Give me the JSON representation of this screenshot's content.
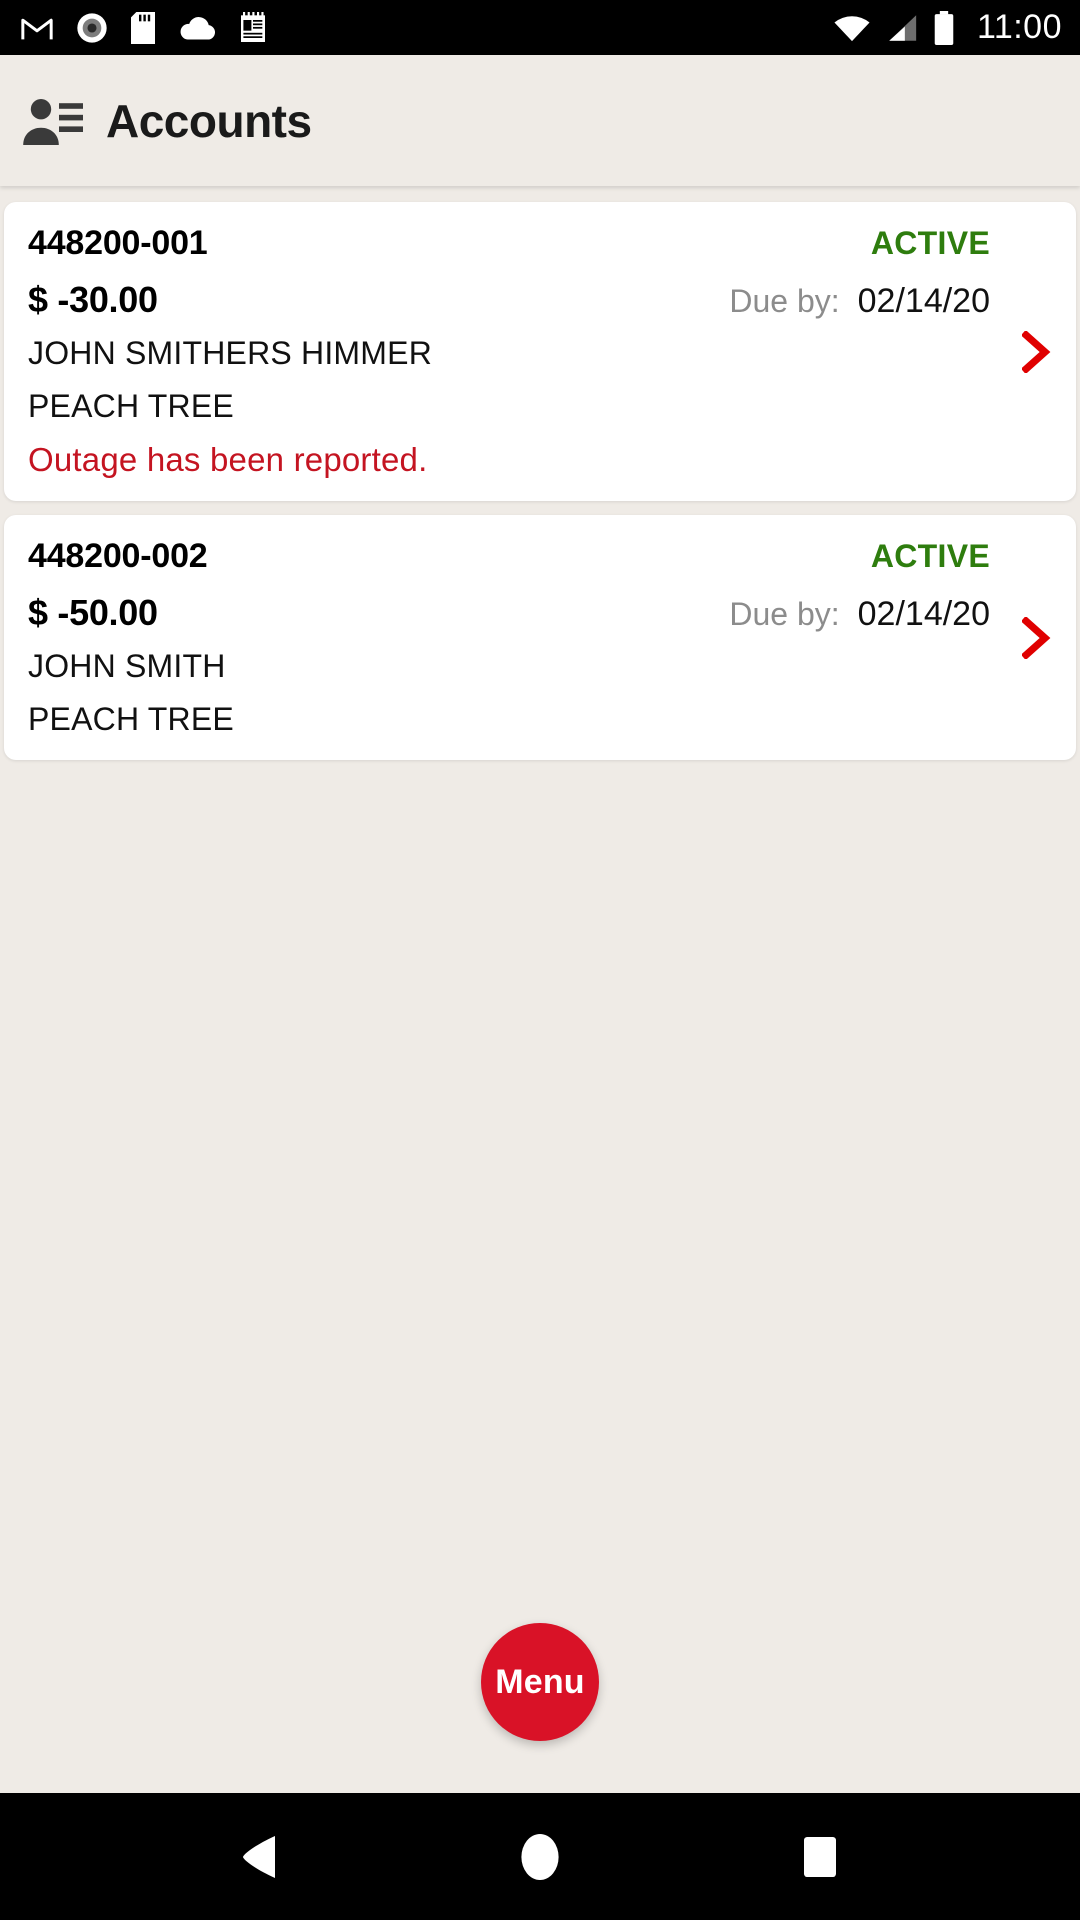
{
  "statusbar": {
    "time": "11:00",
    "left_icons": [
      "gmail-icon",
      "record-disc-icon",
      "sd-card-icon",
      "cloud-icon",
      "notepad-icon"
    ],
    "right_icons": [
      "wifi-icon",
      "cellular-signal-icon",
      "battery-icon"
    ]
  },
  "appbar": {
    "icon": "contacts-icon",
    "title": "Accounts"
  },
  "accounts": [
    {
      "number": "448200-001",
      "status": "ACTIVE",
      "amount": "$ -30.00",
      "due_label": "Due by:",
      "due_date": "02/14/20",
      "customer": "JOHN SMITHERS HIMMER",
      "address": "PEACH TREE",
      "notice": "Outage has been reported."
    },
    {
      "number": "448200-002",
      "status": "ACTIVE",
      "amount": "$ -50.00",
      "due_label": "Due by:",
      "due_date": "02/14/20",
      "customer": "JOHN SMITH",
      "address": "PEACH TREE",
      "notice": ""
    }
  ],
  "fab": {
    "label": "Menu"
  },
  "navbar": {
    "back": "back-triangle-icon",
    "home": "home-circle-icon",
    "recents": "recents-square-icon"
  },
  "colors": {
    "background": "#EFEBE6",
    "card": "#FFFFFF",
    "accent_red": "#D91227",
    "status_green": "#2E7D0E",
    "notice_red": "#C41421",
    "muted_text": "#8C8C8C"
  }
}
